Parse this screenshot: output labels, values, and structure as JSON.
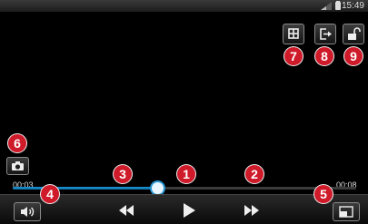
{
  "status_bar": {
    "time": "15:49"
  },
  "playback": {
    "elapsed": "00:03",
    "total": "00:08",
    "progress": 0.42
  },
  "markers": [
    "1",
    "2",
    "3",
    "4",
    "5",
    "6",
    "7",
    "8",
    "9"
  ],
  "icons": {
    "play": "play-icon",
    "rewind": "rewind-icon",
    "fast_forward": "fast-forward-icon",
    "volume": "volume-icon",
    "resize": "resize-icon",
    "capture": "camera-icon",
    "split": "grid-icon",
    "share": "share-icon",
    "lock": "unlock-icon"
  },
  "colors": {
    "marker": "#cf1a2a",
    "progress": "#1d97d6",
    "background": "#000000"
  }
}
